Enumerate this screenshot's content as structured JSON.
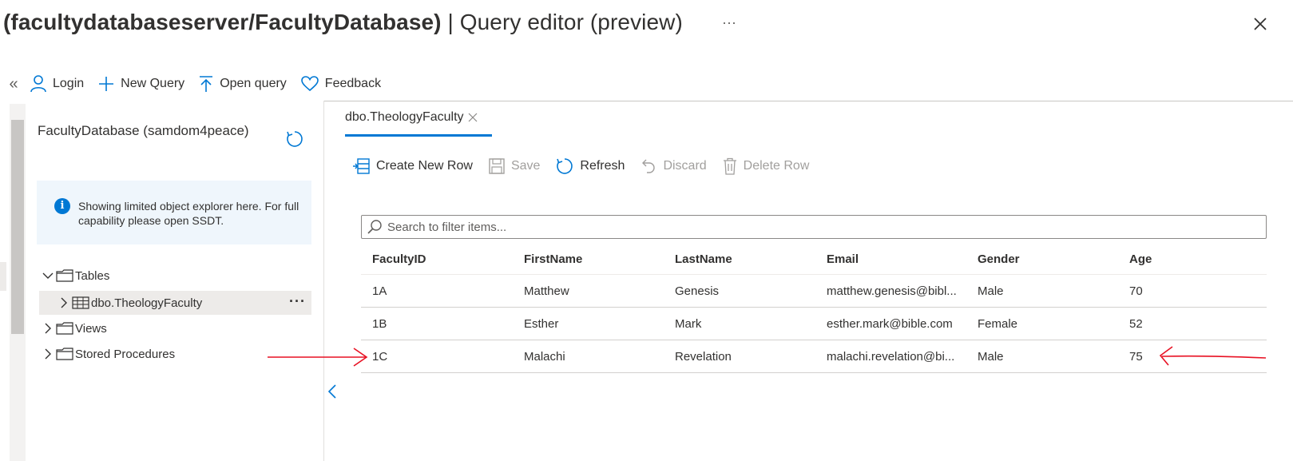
{
  "header": {
    "title_bold": "(facultydatabaseserver/FacultyDatabase)",
    "title_rest": " | Query editor (preview)",
    "more": "···",
    "close_icon": "close-icon"
  },
  "toolbar": {
    "collapse": "«",
    "login": "Login",
    "new_query": "New Query",
    "open_query": "Open query",
    "feedback": "Feedback"
  },
  "explorer": {
    "title": "FacultyDatabase (samdom4peace)",
    "info": "Showing limited object explorer here. For full capability please open SSDT.",
    "tree": {
      "tables": "Tables",
      "table_item": "dbo.TheologyFaculty",
      "item_more": "···",
      "views": "Views",
      "stored_procedures": "Stored Procedures"
    }
  },
  "editor": {
    "tab_label": "dbo.TheologyFaculty",
    "actions": {
      "create_row": "Create New Row",
      "save": "Save",
      "refresh": "Refresh",
      "discard": "Discard",
      "delete_row": "Delete Row"
    },
    "search_placeholder": "Search to filter items...",
    "columns": [
      "FacultyID",
      "FirstName",
      "LastName",
      "Email",
      "Gender",
      "Age"
    ],
    "rows": [
      [
        "1A",
        "Matthew",
        "Genesis",
        "matthew.genesis@bibl...",
        "Male",
        "70"
      ],
      [
        "1B",
        "Esther",
        "Mark",
        "esther.mark@bible.com",
        "Female",
        "52"
      ],
      [
        "1C",
        "Malachi",
        "Revelation",
        "malachi.revelation@bi...",
        "Male",
        "75"
      ]
    ]
  },
  "colors": {
    "accent": "#0078d4",
    "annotation": "#e81123",
    "disabled": "#a19f9d"
  }
}
